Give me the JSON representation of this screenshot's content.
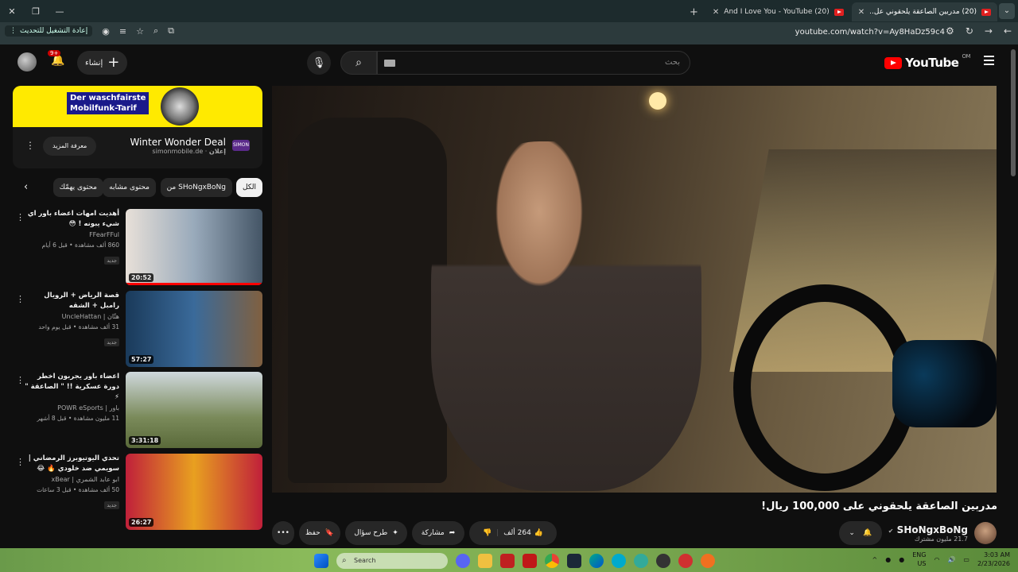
{
  "browser": {
    "tabs": [
      {
        "label": "(20) مدربين الصاعقة يلحقوني عل..",
        "active": true
      },
      {
        "label": "(20) And I Love You - YouTube",
        "active": false
      }
    ],
    "url": "youtube.com/watch?v=Ay8HaDz59c4",
    "update_label": "إعادة التشغيل للتحديث"
  },
  "header": {
    "logo": "YouTube",
    "logo_country": "OM",
    "search_placeholder": "بحث",
    "create_label": "إنشاء",
    "notif_count": "9+"
  },
  "ad": {
    "banner_line1": "Der waschfairste",
    "banner_line2": "Mobilfunk-Tarif",
    "title": "Winter Wonder Deal",
    "domain": "simonmobile.de",
    "ad_label": "إعلان",
    "more_label": "معرفة المزيد",
    "logo": "SIMON"
  },
  "chips": [
    "الكل",
    "من SHoNgxBoNg",
    "محتوى مشابه",
    "محتوى يهمّك"
  ],
  "recommendations": [
    {
      "title": "أهديت امهات اعضاء باور اي شيء يبونه ! 😳",
      "channel": "FFearFFul",
      "stats": "860 ألف مشاهدة • قبل 6 أيام",
      "badge": "جديد",
      "duration": "20:52",
      "progress": 1.0
    },
    {
      "title": "قصة الرياض + الرويال رامبل + الشقه",
      "channel": "هتّان | UncleHattan",
      "stats": "31 ألف مشاهدة • قبل يوم واحد",
      "badge": "جديد",
      "duration": "57:27",
      "progress": 0
    },
    {
      "title": "اعضاء باور يجربون اخطر دورة عسكرية !! \" الصاعقة \" ⚡",
      "channel": "باور | POWR eSports",
      "stats": "11 مليون مشاهدة • قبل 8 أشهر",
      "badge": "",
      "duration": "3:31:18",
      "progress": 0
    },
    {
      "title": "تحدي اليوتيوبرز الرمضاني | سويمي ضد خلودي 🔥 😂",
      "channel": "ابو عابد الشمري | xBear",
      "stats": "50 ألف مشاهدة • قبل 3 ساعات",
      "badge": "جديد",
      "duration": "26:27",
      "progress": 0
    }
  ],
  "video": {
    "title": "مدربين الصاعقة يلحقوني على 100,000 ريال!",
    "channel": "SHoNgxBoNg",
    "subscribers": "21.7 مليون مشترك",
    "likes": "264 ألف",
    "share_label": "مشاركة",
    "ask_label": "طرح سؤال",
    "save_label": "حفظ"
  },
  "taskbar": {
    "search_label": "Search",
    "lang_line1": "ENG",
    "lang_line2": "US",
    "time": "3:03 AM",
    "date": "2/23/2026"
  }
}
